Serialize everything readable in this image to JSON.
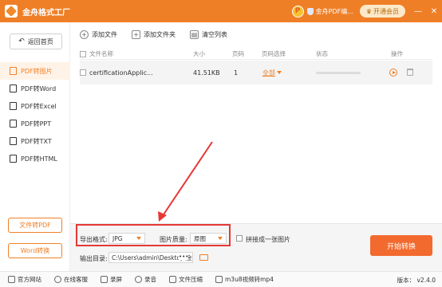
{
  "app": {
    "title": "金舟格式工厂"
  },
  "titlebar": {
    "username": "金舟PDF编...",
    "vip_label": "开通会员",
    "window_controls": [
      "—",
      "✕"
    ]
  },
  "sidebar": {
    "back_label": "返回首页",
    "items": [
      {
        "label": "PDF转图片",
        "active": true
      },
      {
        "label": "PDF转Word",
        "active": false
      },
      {
        "label": "PDF转Excel",
        "active": false
      },
      {
        "label": "PDF转PPT",
        "active": false
      },
      {
        "label": "PDF转TXT",
        "active": false
      },
      {
        "label": "PDF转HTML",
        "active": false
      }
    ],
    "bottom_buttons": [
      "文件转PDF",
      "Word转换"
    ]
  },
  "toolbar": {
    "add_file": "添加文件",
    "add_folder": "添加文件夹",
    "clear_list": "清空列表"
  },
  "table": {
    "headers": [
      "文件名称",
      "大小",
      "页码",
      "页码选择",
      "状态",
      "操作"
    ],
    "rows": [
      {
        "name": "certificationApplic...",
        "size": "41.51KB",
        "pages": "1",
        "page_select": "全部",
        "progress": 0
      }
    ]
  },
  "options": {
    "format_label": "导出格式:",
    "format_value": "JPG",
    "quality_label": "图片质量:",
    "quality_value": "原图",
    "merge_label": "拼接成一张图片",
    "output_label": "输出目录:",
    "output_path": "C:\\Users\\admin\\Desktop\\金",
    "more": "•••",
    "start_label": "开始转换"
  },
  "statusbar": {
    "items": [
      "官方网站",
      "在线客服",
      "录屏",
      "录音",
      "文件压缩",
      "m3u8视频转mp4"
    ],
    "version": "版本： v2.4.0"
  },
  "colors": {
    "accent": "#ef7f26",
    "start_button": "#f26a2e",
    "highlight_box": "#e53935"
  }
}
